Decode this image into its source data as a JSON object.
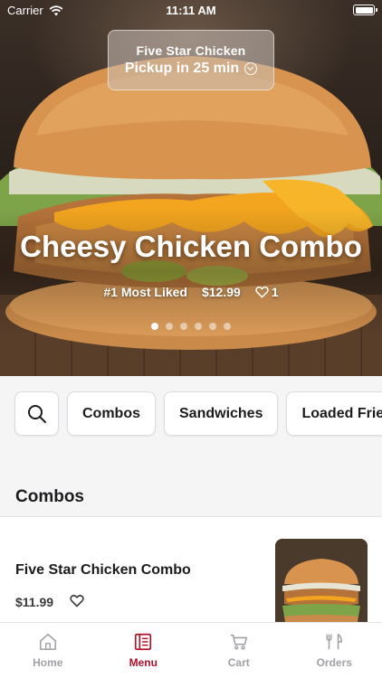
{
  "status_bar": {
    "carrier": "Carrier",
    "time": "11:11 AM"
  },
  "pickup": {
    "store": "Five Star Chicken",
    "eta": "Pickup in 25 min"
  },
  "hero": {
    "title": "Cheesy Chicken Combo",
    "badge": "#1 Most Liked",
    "price": "$12.99",
    "likes": "1",
    "slides": 6,
    "active_slide": 1
  },
  "categories": [
    "Combos",
    "Sandwiches",
    "Loaded Fries"
  ],
  "section": {
    "title": "Combos"
  },
  "item": {
    "name": "Five Star Chicken Combo",
    "price": "$11.99"
  },
  "tabs": [
    {
      "label": "Home",
      "icon": "home-icon"
    },
    {
      "label": "Menu",
      "icon": "menu-icon"
    },
    {
      "label": "Cart",
      "icon": "cart-icon"
    },
    {
      "label": "Orders",
      "icon": "orders-icon"
    }
  ],
  "colors": {
    "accent": "#b1102a",
    "inactive": "#a0a0a6"
  }
}
